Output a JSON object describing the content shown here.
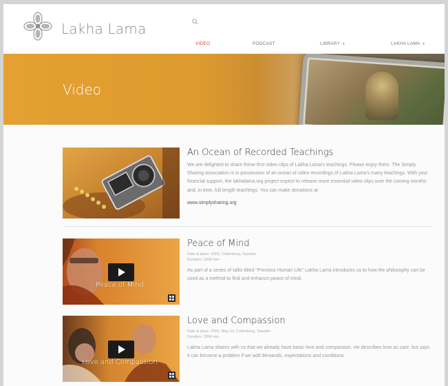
{
  "site": {
    "name": "Lakha Lama"
  },
  "nav": {
    "items": [
      {
        "label": "VIDEO"
      },
      {
        "label": "PODCAST"
      },
      {
        "label": "LIBRARY",
        "caret": "▾"
      },
      {
        "label": "LAKHA LAMA",
        "caret": "▾"
      }
    ],
    "active_color": "#d53f2e"
  },
  "banner": {
    "title": "Video"
  },
  "articles": [
    {
      "title": "An Ocean of Recorded Teachings",
      "description": "We are delighted to share these first video clips of Lakha Lama's teachings. Please enjoy them. The Simply Sharing association is in possession of an ocean of video recordings of Lakha Lama's many teachings. With your financial support, the lakhalama.org project expect to release more essential video clips over the coming months and, in time, full length teachings. You can make donations at",
      "link": "www.simplysharing.org"
    },
    {
      "title": "Peace of Mind",
      "meta_line1": "Date & place: 2003, Cottenburg, Sweden",
      "meta_line2": "Duration: 2008 min",
      "description": "As part of a series of talks titled \"Precious Human Life\" Lakha Lama introduces us to how the philosophy can be used as a method to find and enhance peace of mind.",
      "thumb_caption": "Peace of Mind"
    },
    {
      "title": "Love and Compassion",
      "meta_line1": "Date & place: 2001, May 13, Cottenburg, Sweden",
      "meta_line2": "Duration: 2056 min",
      "description": "Lakha Lama shares with us that we already have basic love and compassion. He describes love as care, but says it can become a problem if we add demands, expectations and conditions.",
      "thumb_caption": "Love and Compassion"
    }
  ],
  "colors": {
    "banner": "#e5a032",
    "accent": "#d53f2e"
  }
}
